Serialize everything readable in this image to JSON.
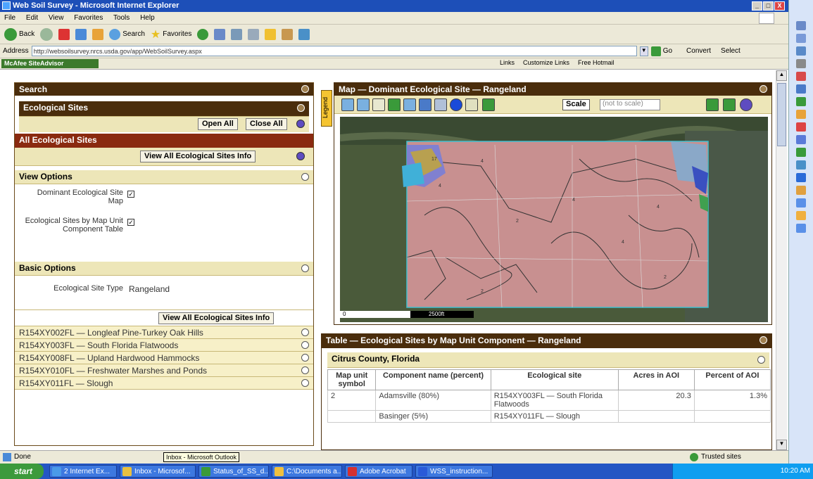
{
  "window": {
    "title": "Web Soil Survey - Microsoft Internet Explorer",
    "minimize": "_",
    "maximize": "□",
    "close": "X"
  },
  "menu": [
    "File",
    "Edit",
    "View",
    "Favorites",
    "Tools",
    "Help"
  ],
  "toolbar": {
    "back": "Back",
    "search": "Search",
    "favorites": "Favorites"
  },
  "address": {
    "label": "Address",
    "url": "http://websoilsurvey.nrcs.usda.gov/app/WebSoilSurvey.aspx",
    "go": "Go",
    "convert": "Convert",
    "select": "Select"
  },
  "linksbar": {
    "mcafee": "McAfee SiteAdvisor",
    "links": "Links",
    "customize": "Customize Links",
    "hotmail": "Free Hotmail"
  },
  "left": {
    "search": "Search",
    "eco_sites": "Ecological Sites",
    "open_all": "Open All",
    "close_all": "Close All",
    "all_eco": "All Ecological Sites",
    "view_all_btn": "View All Ecological Sites Info",
    "view_options": "View Options",
    "opt1": "Dominant Ecological Site Map",
    "opt2": "Ecological Sites by Map Unit Component Table",
    "check": "✓",
    "basic_options": "Basic Options",
    "eco_type_label": "Ecological Site Type",
    "eco_type_value": "Rangeland",
    "view_all_btn2": "View All Ecological Sites Info",
    "sites": [
      "R154XY002FL — Longleaf Pine-Turkey Oak Hills",
      "R154XY003FL — South Florida Flatwoods",
      "R154XY008FL — Upland Hardwood Hammocks",
      "R154XY010FL — Freshwater Marshes and Ponds",
      "R154XY011FL — Slough"
    ]
  },
  "legend_tab": "Legend",
  "map": {
    "title": "Map — Dominant Ecological Site — Rangeland",
    "scale_btn": "Scale",
    "scale_value": "(not to scale)",
    "scale_bar": "2500ft",
    "scale_zero": "0"
  },
  "table": {
    "title": "Table — Ecological Sites by Map Unit Component — Rangeland",
    "county": "Citrus County, Florida",
    "headers": [
      "Map unit symbol",
      "Component name (percent)",
      "Ecological site",
      "Acres in AOI",
      "Percent of AOI"
    ],
    "rows": [
      [
        "2",
        "Adamsville (80%)",
        "R154XY003FL — South Florida Flatwoods",
        "20.3",
        "1.3%"
      ],
      [
        "",
        "Basinger (5%)",
        "R154XY011FL — Slough",
        "",
        ""
      ]
    ]
  },
  "status": {
    "left": "Done",
    "zone": "Trusted sites"
  },
  "tooltip": "Inbox - Microsoft Outlook",
  "taskbar": {
    "start": "start",
    "tasks": [
      "2 Internet Ex...",
      "Inbox - Microsof...",
      "Status_of_SS_d...",
      "C:\\Documents a...",
      "Adobe Acrobat",
      "WSS_instruction..."
    ],
    "clock": "10:20 AM"
  }
}
